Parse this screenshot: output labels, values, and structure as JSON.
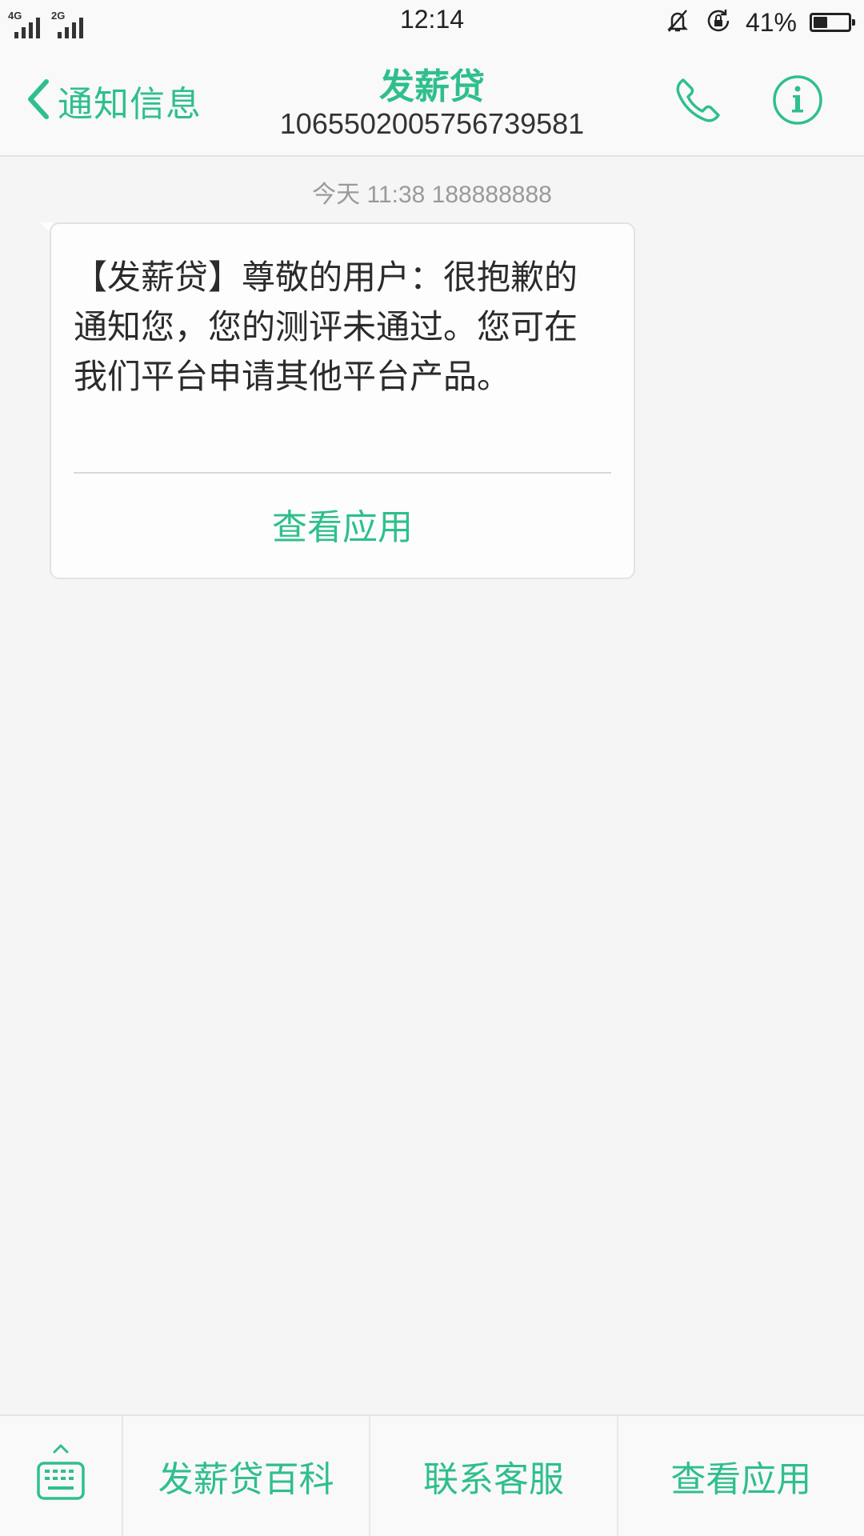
{
  "status_bar": {
    "network_1": "4G",
    "network_2": "2G",
    "time": "12:14",
    "battery_percent": "41%",
    "battery_level": 0.41,
    "icons": [
      "mute-icon",
      "rotation-lock-icon",
      "battery-icon"
    ]
  },
  "header": {
    "back_label": "通知信息",
    "title": "发薪贷",
    "sender_number": "1065502005756739581",
    "icons": [
      "chevron-left-icon",
      "phone-icon",
      "info-icon"
    ]
  },
  "conversation": {
    "timestamp": "今天 11:38  188888888",
    "message": {
      "text": "【发薪贷】尊敬的用户：很抱歉的通知您，您的测评未通过。您可在我们平台申请其他平台产品。",
      "action_label": "查看应用"
    }
  },
  "bottom_bar": {
    "keyboard_icon": "keyboard-icon",
    "menu": [
      {
        "label": "发薪贷百科"
      },
      {
        "label": "联系客服"
      },
      {
        "label": "查看应用"
      }
    ]
  },
  "colors": {
    "accent": "#2fbf8c",
    "background": "#f5f5f5",
    "bar": "#f9f9f9"
  }
}
